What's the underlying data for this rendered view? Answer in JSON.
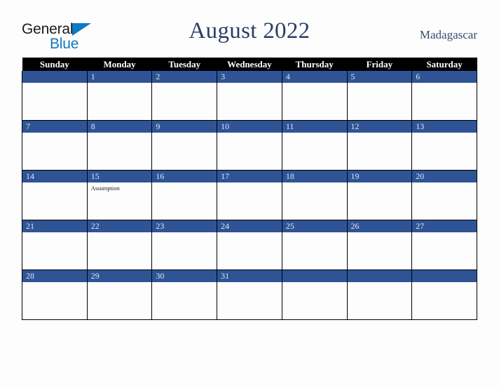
{
  "brand": {
    "name_part1": "General",
    "name_part2": "Blue",
    "triangle_color": "#0d7ac4",
    "blue_color": "#1277bd"
  },
  "header": {
    "title": "August 2022",
    "country": "Madagascar"
  },
  "theme": {
    "header_row_bg": "#000000",
    "daybar_bg": "#2f5496",
    "daybar_text": "#dfe4ef",
    "title_color": "#2c3e63",
    "page_bg": "#fdfdfd",
    "grid_border": "#000000"
  },
  "calendar": {
    "month": "August",
    "year": "2022",
    "weekday_headers": [
      "Sunday",
      "Monday",
      "Tuesday",
      "Wednesday",
      "Thursday",
      "Friday",
      "Saturday"
    ],
    "weeks": [
      [
        {
          "day": "",
          "events": []
        },
        {
          "day": "1",
          "events": []
        },
        {
          "day": "2",
          "events": []
        },
        {
          "day": "3",
          "events": []
        },
        {
          "day": "4",
          "events": []
        },
        {
          "day": "5",
          "events": []
        },
        {
          "day": "6",
          "events": []
        }
      ],
      [
        {
          "day": "7",
          "events": []
        },
        {
          "day": "8",
          "events": []
        },
        {
          "day": "9",
          "events": []
        },
        {
          "day": "10",
          "events": []
        },
        {
          "day": "11",
          "events": []
        },
        {
          "day": "12",
          "events": []
        },
        {
          "day": "13",
          "events": []
        }
      ],
      [
        {
          "day": "14",
          "events": []
        },
        {
          "day": "15",
          "events": [
            "Assumption"
          ]
        },
        {
          "day": "16",
          "events": []
        },
        {
          "day": "17",
          "events": []
        },
        {
          "day": "18",
          "events": []
        },
        {
          "day": "19",
          "events": []
        },
        {
          "day": "20",
          "events": []
        }
      ],
      [
        {
          "day": "21",
          "events": []
        },
        {
          "day": "22",
          "events": []
        },
        {
          "day": "23",
          "events": []
        },
        {
          "day": "24",
          "events": []
        },
        {
          "day": "25",
          "events": []
        },
        {
          "day": "26",
          "events": []
        },
        {
          "day": "27",
          "events": []
        }
      ],
      [
        {
          "day": "28",
          "events": []
        },
        {
          "day": "29",
          "events": []
        },
        {
          "day": "30",
          "events": []
        },
        {
          "day": "31",
          "events": []
        },
        {
          "day": "",
          "events": []
        },
        {
          "day": "",
          "events": []
        },
        {
          "day": "",
          "events": []
        }
      ]
    ]
  }
}
